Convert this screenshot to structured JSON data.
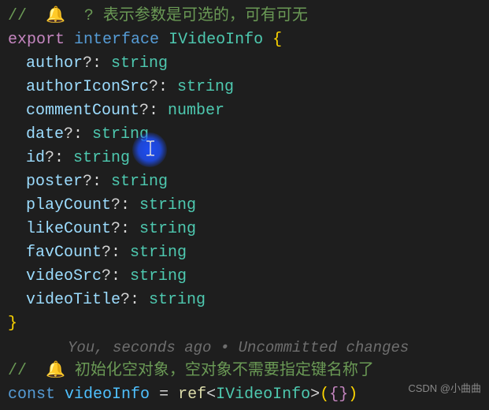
{
  "comments": {
    "top": "//  🔔  ? 表示参数是可选的，可有可无",
    "bottom": "//  🔔 初始化空对象，空对象不需要指定键名称了"
  },
  "interface": {
    "export": "export",
    "keyword": "interface",
    "name": "IVideoInfo",
    "openBrace": "{",
    "closeBrace": "}",
    "members": [
      {
        "name": "author",
        "type": "string"
      },
      {
        "name": "authorIconSrc",
        "type": "string"
      },
      {
        "name": "commentCount",
        "type": "number"
      },
      {
        "name": "date",
        "type": "string"
      },
      {
        "name": "id",
        "type": "string"
      },
      {
        "name": "poster",
        "type": "string"
      },
      {
        "name": "playCount",
        "type": "string"
      },
      {
        "name": "likeCount",
        "type": "string"
      },
      {
        "name": "favCount",
        "type": "string"
      },
      {
        "name": "videoSrc",
        "type": "string"
      },
      {
        "name": "videoTitle",
        "type": "string"
      }
    ]
  },
  "gitlens": "You, seconds ago • Uncommitted changes",
  "constLine": {
    "const": "const",
    "name": "videoInfo",
    "eq": " = ",
    "fn": "ref",
    "lt": "<",
    "gen": "IVideoInfo",
    "gt": ">",
    "lp": "(",
    "lb": "{",
    "rb": "}",
    "rp": ")"
  },
  "watermark": "CSDN @小曲曲"
}
